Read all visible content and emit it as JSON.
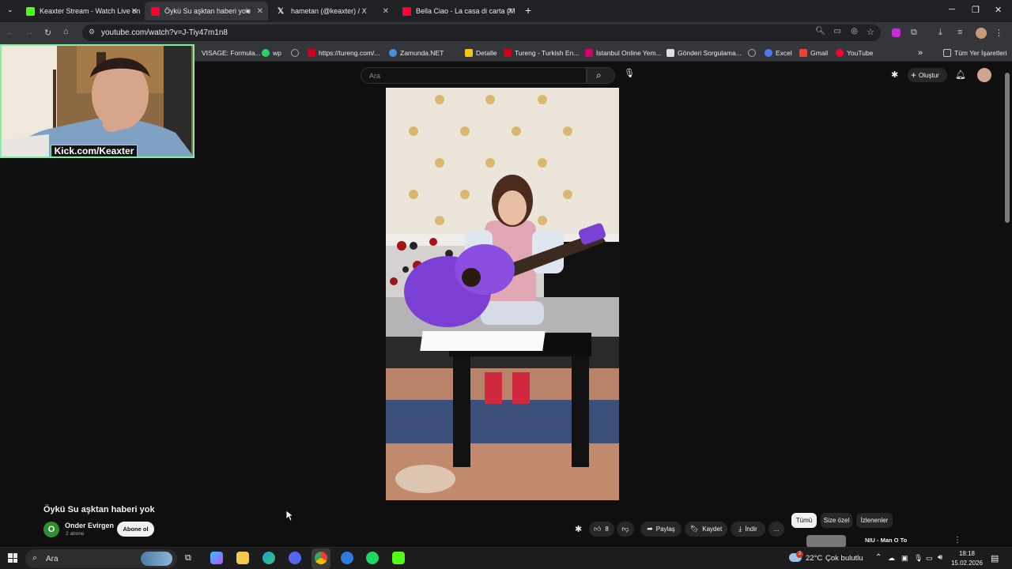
{
  "browser": {
    "tabs": [
      {
        "label": "Keaxter Stream - Watch Live on",
        "icon": "kick-icon",
        "color": "#53fc18"
      },
      {
        "label": "Öykü Su aşktan haberi yok",
        "icon": "youtube-icon",
        "color": "#ff0033"
      },
      {
        "label": "hametan (@keaxter) / X",
        "icon": "x-icon",
        "color": "#e8eaed"
      },
      {
        "label": "Bella Ciao - La casa di carta (M",
        "icon": "youtube-icon",
        "color": "#ff0033"
      }
    ],
    "url": "youtube.com/watch?v=J-Tiy47m1n8",
    "bookmarks": [
      "VISAGE: Formula...",
      "wp",
      "https://tureng.com/...",
      "Zamunda.NET",
      "Detalle",
      "Tureng - Turkish En...",
      "İstanbul Online Yem...",
      "Gönderi Sorgulama...",
      "Excel",
      "Gmail",
      "YouTube"
    ],
    "bookmarks_overflow": "»",
    "all_bookmarks": "Tüm Yer İşaretleri"
  },
  "youtube": {
    "search_placeholder": "Ara",
    "create_label": "Oluştur",
    "video_title": "Öykü Su aşktan haberi yok",
    "channel_initial": "O",
    "channel_name": "Onder Evirgen",
    "subscribers": "2 abone",
    "subscribe_label": "Abone ol",
    "likes": "8",
    "share_label": "Paylaş",
    "save_label": "Kaydet",
    "download_label": "İndir",
    "more_label": "...",
    "chips": [
      "Tümü",
      "Size özel",
      "İzlenenler"
    ],
    "next_video_title": "NIU - Man O To"
  },
  "overlay": {
    "watermark": "Kick.com/Keaxter"
  },
  "taskbar": {
    "search_placeholder": "Ara",
    "weather_temp": "22°C",
    "weather_text": "Çok bulutlu",
    "time": "18:18",
    "date": "15.02.2026",
    "weather_badge": "2"
  }
}
